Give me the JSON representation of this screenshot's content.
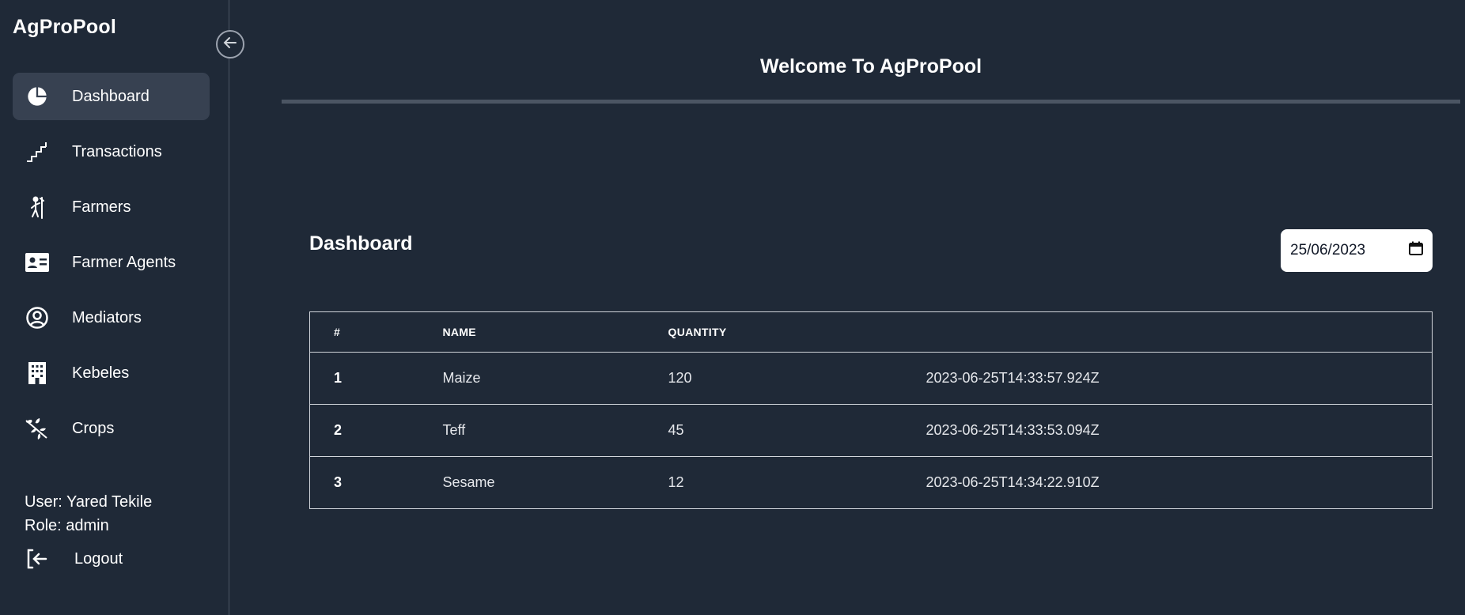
{
  "brand": "AgProPool",
  "sidebar": {
    "items": [
      {
        "label": "Dashboard",
        "icon": "pie-chart-icon",
        "active": true
      },
      {
        "label": "Transactions",
        "icon": "stairs-icon"
      },
      {
        "label": "Farmers",
        "icon": "farmer-icon"
      },
      {
        "label": "Farmer Agents",
        "icon": "id-card-icon"
      },
      {
        "label": "Mediators",
        "icon": "user-circle-icon"
      },
      {
        "label": "Kebeles",
        "icon": "building-icon"
      },
      {
        "label": "Crops",
        "icon": "leaf-branch-icon"
      }
    ],
    "user": "User: Yared Tekile",
    "role": "Role: admin",
    "logout": "Logout"
  },
  "header": {
    "welcome": "Welcome To AgProPool"
  },
  "main": {
    "title": "Dashboard",
    "date_value": "25/06/2023",
    "table": {
      "headers": [
        "#",
        "NAME",
        "QUANTITY",
        ""
      ],
      "rows": [
        [
          "1",
          "Maize",
          "120",
          "2023-06-25T14:33:57.924Z"
        ],
        [
          "2",
          "Teff",
          "45",
          "2023-06-25T14:33:53.094Z"
        ],
        [
          "3",
          "Sesame",
          "12",
          "2023-06-25T14:34:22.910Z"
        ]
      ]
    }
  },
  "colors": {
    "background": "#1f2937",
    "active_item": "#374151",
    "divider": "#4b5563"
  }
}
